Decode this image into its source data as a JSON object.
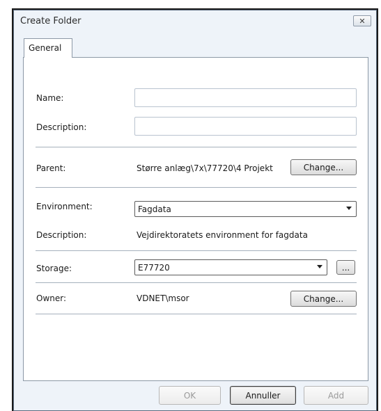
{
  "window": {
    "title": "Create Folder",
    "close_glyph": "✕"
  },
  "tabs": [
    {
      "label": "General"
    }
  ],
  "form": {
    "name_label": "Name:",
    "name_value": "",
    "description_label": "Description:",
    "description_value": "",
    "parent_label": "Parent:",
    "parent_value": "Større anlæg\\7x\\77720\\4 Projekt",
    "parent_change_label": "Change...",
    "environment_label": "Environment:",
    "environment_value": "Fagdata",
    "env_description_label": "Description:",
    "env_description_value": "Vejdirektoratets environment for fagdata",
    "storage_label": "Storage:",
    "storage_value": "E77720",
    "storage_browse_label": "...",
    "owner_label": "Owner:",
    "owner_value": "VDNET\\msor",
    "owner_change_label": "Change..."
  },
  "footer": {
    "ok_label": "OK",
    "cancel_label": "Annuller",
    "add_label": "Add"
  },
  "icons": {
    "close": "close-icon",
    "dropdown": "chevron-down-icon"
  },
  "colors": {
    "window_bg": "#eef3f9",
    "panel_bg": "#ffffff",
    "border": "#8c98a6"
  }
}
